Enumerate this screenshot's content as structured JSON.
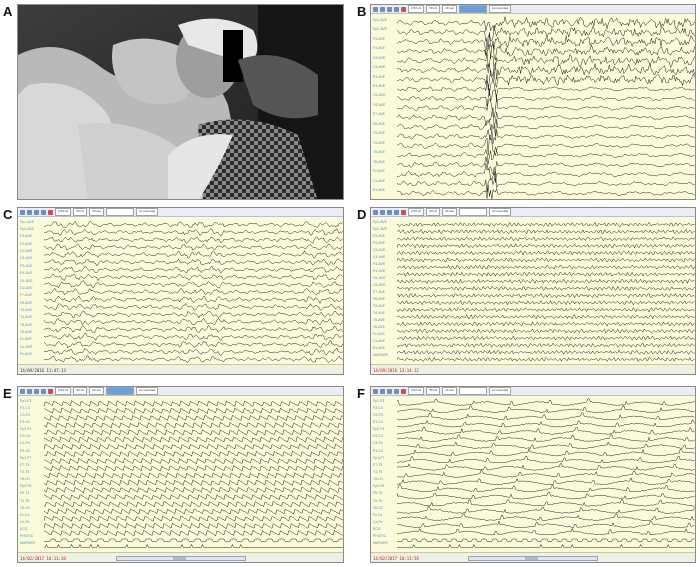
{
  "figure": {
    "panel_labels": [
      "A",
      "B",
      "C",
      "D",
      "E",
      "F"
    ],
    "icons": {
      "toolbar_buttons": "nav-arrow-icons",
      "photo": "patient-video-frame",
      "censor": "black-censor-bar"
    },
    "colors": {
      "eeg_background": "#fbfbdc",
      "trace": "#1a1a1a",
      "channel_label": "#5a8fb0",
      "annotation_red": "#cc2222",
      "toolbar_highlight": "#6aa0d8"
    }
  },
  "panels": {
    "B": {
      "toolbar": [
        "0.53 Hz",
        "50 Hz",
        "20 sec",
        "",
        "As recorded"
      ],
      "channels": [
        "Fp1-AVE",
        "Fp2-AVE",
        "F3-AVE",
        "F4-AVE",
        "C3-AVE",
        "C4-AVE",
        "P3-AVE",
        "P4-AVE",
        "O1-AVE",
        "O2-AVE",
        "F7-AVE",
        "F8-AVE",
        "T3-AVE",
        "T4-AVE",
        "T5-AVE",
        "T6-AVE",
        "Fz-AVE",
        "Cz-AVE",
        "Pz-AVE"
      ],
      "annotations": [
        "",
        ""
      ],
      "timestamp": ""
    },
    "C": {
      "toolbar": [
        "0.53 Hz",
        "50 Hz",
        "20 sec",
        "",
        "As recorded"
      ],
      "channels": [
        "Fp1-AVE",
        "Fp2-AVE",
        "F3-AVE",
        "F4-AVE",
        "C3-AVE",
        "C4-AVE",
        "P3-AVE",
        "P4-AVE",
        "O1-AVE",
        "O2-AVE",
        "F7-AVE",
        "F8-AVE",
        "T3-AVE",
        "T4-AVE",
        "T5-AVE",
        "T6-AVE",
        "Fz-AVE",
        "Cz-AVE",
        "Pz-AVE"
      ],
      "annotation": "",
      "timestamp": "14/09/2016 11:47:13"
    },
    "D": {
      "toolbar": [
        "0.53 Hz",
        "50 Hz",
        "20 sec",
        "",
        "As recorded"
      ],
      "channels": [
        "Fp1-AVE",
        "Fp2-AVE",
        "F3-AVE",
        "F4-AVE",
        "C3-AVE",
        "C4-AVE",
        "P3-AVE",
        "P4-AVE",
        "O1-AVE",
        "O2-AVE",
        "F7-AVE",
        "F8-AVE",
        "T3-AVE",
        "T4-AVE",
        "T5-AVE",
        "T6-AVE",
        "Fz-AVE",
        "Cz-AVE",
        "Pz-AVE",
        "MARKER"
      ],
      "annotation": "",
      "timestamp": "14/09/2016 13:14:12"
    },
    "E": {
      "toolbar": [
        "0.53 Hz",
        "50 Hz",
        "20 sec",
        "",
        "As recorded"
      ],
      "channels": [
        "Fp1-F3",
        "F3-C3",
        "C3-P3",
        "P3-O1",
        "Fp2-F4",
        "F4-C4",
        "C4-P4",
        "P4-O2",
        "Fp1-F7",
        "F7-T3",
        "T3-T5",
        "T5-O1",
        "Fp2-F8",
        "F8-T4",
        "T4-T6",
        "T6-O2",
        "Fz-Cz",
        "Cz-Pz",
        "ECG",
        "PHOTIC",
        "MARKER"
      ],
      "timestamp": "14/02/2017 10:11:38"
    },
    "F": {
      "toolbar": [
        "0.53 Hz",
        "50 Hz",
        "20 sec",
        "",
        "As recorded"
      ],
      "channels": [
        "Fp1-F3",
        "F3-C3",
        "C3-P3",
        "P3-O1",
        "Fp2-F4",
        "F4-C4",
        "C4-P4",
        "P4-O2",
        "Fp1-F7",
        "F7-T3",
        "T3-T5",
        "T5-O1",
        "Fp2-F8",
        "F8-T4",
        "T4-T6",
        "T6-O2",
        "Fz-Cz",
        "Cz-Pz",
        "ECG",
        "PHOTIC",
        "MARKER"
      ],
      "timestamp": "14/02/2017 10:11:58"
    }
  }
}
